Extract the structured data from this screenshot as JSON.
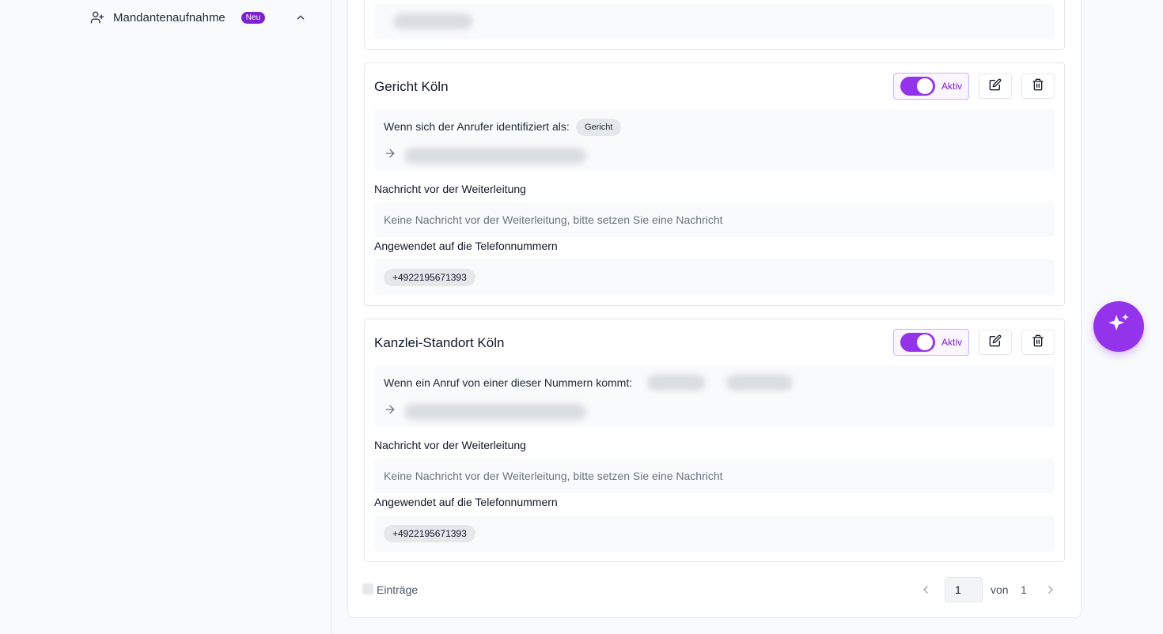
{
  "sidebar": {
    "nav_item": {
      "label": "Mandantenaufnahme",
      "badge": "Neu",
      "icon": "user-plus-icon"
    }
  },
  "rules": [
    {
      "title": "Gericht Köln",
      "status_label": "Aktiv",
      "active": true,
      "condition_text": "Wenn sich der Anrufer identifiziert als:",
      "condition_tag": "Gericht",
      "message_label": "Nachricht vor der Weiterleitung",
      "message_text": "Keine Nachricht vor der Weiterleitung, bitte setzen Sie eine Nachricht",
      "numbers_label": "Angewendet auf die Telefonnummern",
      "numbers": [
        "+4922195671393"
      ]
    },
    {
      "title": "Kanzlei-Standort Köln",
      "status_label": "Aktiv",
      "active": true,
      "condition_text": "Wenn ein Anruf von einer dieser Nummern kommt:",
      "message_label": "Nachricht vor der Weiterleitung",
      "message_text": "Keine Nachricht vor der Weiterleitung, bitte setzen Sie eine Nachricht",
      "numbers_label": "Angewendet auf die Telefonnummern",
      "numbers": [
        "+4922195671393"
      ]
    }
  ],
  "pagination": {
    "entries_label": "Einträge",
    "current_page": "1",
    "of_label": "von",
    "total_pages": "1"
  },
  "colors": {
    "accent": "#9333ea",
    "badge": "#7e22ce"
  }
}
